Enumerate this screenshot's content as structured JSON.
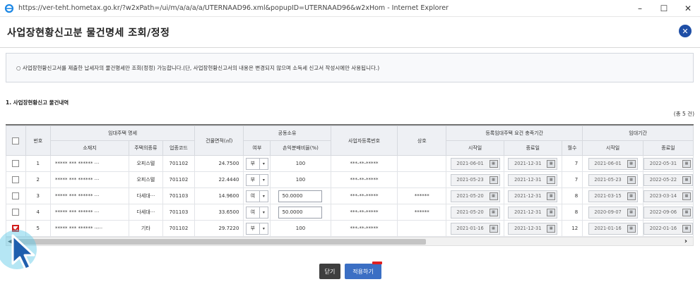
{
  "window": {
    "title": "https://ver-teht.hometax.go.kr/?w2xPath=/ui/m/a/a/a/a/UTERNAAD96.xml&popupID=UTERNAAD96&w2xHom - Internet Explorer",
    "minimize": "–",
    "maximize": "☐",
    "close": "✕"
  },
  "popup": {
    "title": "사업장현황신고분 물건명세 조회/정정",
    "close_icon": "✕"
  },
  "notice": "○ 사업장현황신고서를 제출한 납세자의 물건명세만 조회(정정) 가능합니다.(단, 사업장현황신고서의 내용은 변경되지 않으며 소득세 신고서 작성시에만 사용됩니다.)",
  "section_title": "1. 사업장현황신고 물건내역",
  "total_count": "(총 5 건)",
  "table": {
    "headers": {
      "number": "번호",
      "rental_group": "임대주택 명세",
      "address": "소재지",
      "housing_type": "주택의종류",
      "industry_code": "업종코드",
      "building_area": "건물면적(㎡)",
      "coowner_group": "공동소유",
      "whether": "여부",
      "pl_ratio": "손익분배비율(%)",
      "biz_reg_no": "사업자등록번호",
      "trade_name": "상호",
      "reg_period_group": "등록임대주택 요건 충족기간",
      "start_date": "시작일",
      "end_date": "종료일",
      "months": "월수",
      "rental_period_group": "임대기간",
      "rental_start": "시작일",
      "rental_end": "종료일"
    },
    "rows": [
      {
        "no": "1",
        "address": "***** *** ****** ···",
        "type": "오피스텔",
        "code": "701102",
        "area": "24.7500",
        "coowned": "부",
        "ratio": "100",
        "ratio_editable": false,
        "bizno": "***-**-*****",
        "trade": "",
        "reg_start": "2021-06-01",
        "reg_end": "2021-12-31",
        "months": "7",
        "rent_start": "2021-06-01",
        "rent_end": "2022-05-31",
        "checked": false
      },
      {
        "no": "2",
        "address": "***** *** ****** ···",
        "type": "오피스텔",
        "code": "701102",
        "area": "22.4440",
        "coowned": "부",
        "ratio": "100",
        "ratio_editable": false,
        "bizno": "***-**-*****",
        "trade": "",
        "reg_start": "2021-05-23",
        "reg_end": "2021-12-31",
        "months": "7",
        "rent_start": "2021-05-23",
        "rent_end": "2022-05-22",
        "checked": false
      },
      {
        "no": "3",
        "address": "***** *** ****** ···",
        "type": "다세대···",
        "code": "701103",
        "area": "14.9600",
        "coowned": "여",
        "ratio": "50.0000",
        "ratio_editable": true,
        "bizno": "***-**-*****",
        "trade": "******",
        "reg_start": "2021-05-20",
        "reg_end": "2021-12-31",
        "months": "8",
        "rent_start": "2021-03-15",
        "rent_end": "2023-03-14",
        "checked": false
      },
      {
        "no": "4",
        "address": "***** *** ****** ···",
        "type": "다세대···",
        "code": "701103",
        "area": "33.6500",
        "coowned": "여",
        "ratio": "50.0000",
        "ratio_editable": true,
        "bizno": "***-**-*****",
        "trade": "******",
        "reg_start": "2021-05-20",
        "reg_end": "2021-12-31",
        "months": "8",
        "rent_start": "2020-09-07",
        "rent_end": "2022-09-06",
        "checked": false
      },
      {
        "no": "5",
        "address": "***** *** ****** ·-···",
        "type": "기타",
        "code": "701102",
        "area": "29.7220",
        "coowned": "부",
        "ratio": "100",
        "ratio_editable": false,
        "bizno": "***-**-*****",
        "trade": "",
        "reg_start": "2021-01-16",
        "reg_end": "2021-12-31",
        "months": "12",
        "rent_start": "2021-01-16",
        "rent_end": "2022-01-16",
        "checked": true
      }
    ]
  },
  "calendar_icon_text": "▦",
  "select_arrow": "▾",
  "scroll": {
    "left": "◀",
    "right": "›"
  },
  "buttons": {
    "close": "닫기",
    "apply": "적용하기"
  }
}
